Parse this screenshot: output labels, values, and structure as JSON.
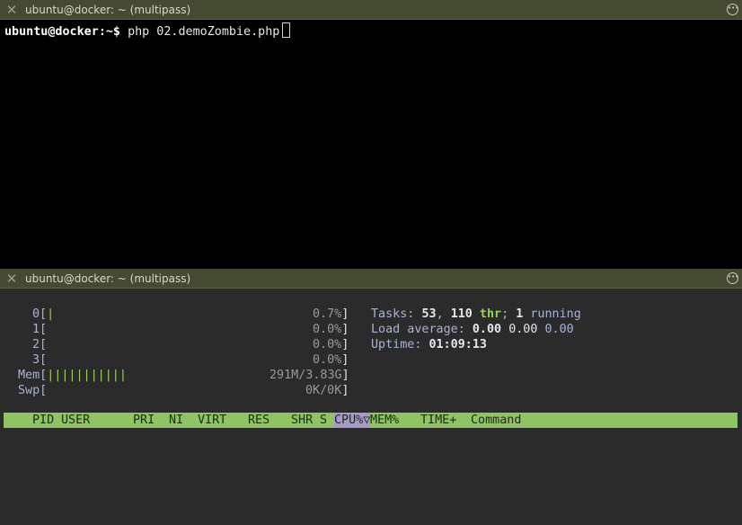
{
  "top_pane": {
    "title": "ubuntu@docker: ~ (multipass)",
    "prompt_user": "ubuntu@docker",
    "prompt_rest": ":~$ ",
    "command": "php 02.demoZombie.php"
  },
  "bottom_pane": {
    "title": "ubuntu@docker: ~ (multipass)"
  },
  "htop": {
    "cpus": [
      {
        "label": "0[",
        "bar": "|",
        "value": "0.7%",
        "level": 0.007
      },
      {
        "label": "1[",
        "bar": "",
        "value": "0.0%",
        "level": 0.0
      },
      {
        "label": "2[",
        "bar": "",
        "value": "0.0%",
        "level": 0.0
      },
      {
        "label": "3[",
        "bar": "",
        "value": "0.0%",
        "level": 0.0
      }
    ],
    "mem": {
      "label": "Mem[",
      "bar": "|||||||||||",
      "value": "291M/3.83G"
    },
    "swp": {
      "label": "Swp[",
      "bar": "",
      "value": "0K/0K"
    },
    "close_bracket": "]",
    "tasks": {
      "label": "Tasks: ",
      "count": "53",
      "sep1": ", ",
      "threads": "110",
      "thr_label": " thr",
      "sep2": "; ",
      "running": "1",
      "running_label": " running"
    },
    "load": {
      "label": "Load average: ",
      "v1": "0.00",
      "v2": "0.00",
      "v3": "0.00"
    },
    "uptime": {
      "label": "Uptime: ",
      "value": "01:09:13"
    },
    "columns": [
      "PID",
      "USER",
      "PRI",
      "NI",
      "VIRT",
      "RES",
      "SHR",
      "S",
      "CPU%▽",
      "MEM%",
      "TIME+",
      "Command"
    ]
  },
  "icons": {
    "close": "close-icon",
    "more": "more-icon"
  }
}
